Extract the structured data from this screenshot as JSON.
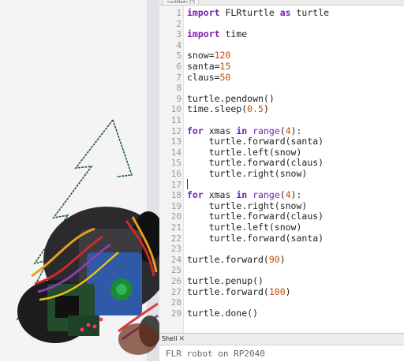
{
  "editor": {
    "tab_label": "<untitled> [*]",
    "lines": [
      {
        "n": "1",
        "parts": [
          {
            "t": "import",
            "c": "kw"
          },
          {
            "t": " FLRturtle ",
            "c": ""
          },
          {
            "t": "as",
            "c": "kw"
          },
          {
            "t": " turtle",
            "c": ""
          }
        ]
      },
      {
        "n": "2",
        "parts": []
      },
      {
        "n": "3",
        "parts": [
          {
            "t": "import",
            "c": "kw"
          },
          {
            "t": " time",
            "c": ""
          }
        ]
      },
      {
        "n": "4",
        "parts": []
      },
      {
        "n": "5",
        "parts": [
          {
            "t": "snow=",
            "c": ""
          },
          {
            "t": "120",
            "c": "num"
          }
        ]
      },
      {
        "n": "6",
        "parts": [
          {
            "t": "santa=",
            "c": ""
          },
          {
            "t": "15",
            "c": "num"
          }
        ]
      },
      {
        "n": "7",
        "parts": [
          {
            "t": "claus=",
            "c": ""
          },
          {
            "t": "50",
            "c": "num"
          }
        ]
      },
      {
        "n": "8",
        "parts": []
      },
      {
        "n": "9",
        "parts": [
          {
            "t": "turtle.pendown()",
            "c": ""
          }
        ]
      },
      {
        "n": "10",
        "parts": [
          {
            "t": "time.sleep(",
            "c": ""
          },
          {
            "t": "0.5",
            "c": "num"
          },
          {
            "t": ")",
            "c": ""
          }
        ]
      },
      {
        "n": "11",
        "parts": []
      },
      {
        "n": "12",
        "parts": [
          {
            "t": "for",
            "c": "kw"
          },
          {
            "t": " xmas ",
            "c": ""
          },
          {
            "t": "in",
            "c": "kw"
          },
          {
            "t": " ",
            "c": ""
          },
          {
            "t": "range",
            "c": "bi"
          },
          {
            "t": "(",
            "c": ""
          },
          {
            "t": "4",
            "c": "num"
          },
          {
            "t": "):",
            "c": ""
          }
        ]
      },
      {
        "n": "13",
        "parts": [
          {
            "t": "    turtle.forward(santa)",
            "c": ""
          }
        ]
      },
      {
        "n": "14",
        "parts": [
          {
            "t": "    turtle.left(snow)",
            "c": ""
          }
        ]
      },
      {
        "n": "15",
        "parts": [
          {
            "t": "    turtle.forward(claus)",
            "c": ""
          }
        ]
      },
      {
        "n": "16",
        "parts": [
          {
            "t": "    turtle.right(snow)",
            "c": ""
          }
        ]
      },
      {
        "n": "17",
        "parts": []
      },
      {
        "n": "18",
        "parts": [
          {
            "t": "for",
            "c": "kw"
          },
          {
            "t": " xmas ",
            "c": ""
          },
          {
            "t": "in",
            "c": "kw"
          },
          {
            "t": " ",
            "c": ""
          },
          {
            "t": "range",
            "c": "bi"
          },
          {
            "t": "(",
            "c": ""
          },
          {
            "t": "4",
            "c": "num"
          },
          {
            "t": "):",
            "c": ""
          }
        ]
      },
      {
        "n": "19",
        "parts": [
          {
            "t": "    turtle.right(snow)",
            "c": ""
          }
        ]
      },
      {
        "n": "20",
        "parts": [
          {
            "t": "    turtle.forward(claus)",
            "c": ""
          }
        ]
      },
      {
        "n": "21",
        "parts": [
          {
            "t": "    turtle.left(snow)",
            "c": ""
          }
        ]
      },
      {
        "n": "22",
        "parts": [
          {
            "t": "    turtle.forward(santa)",
            "c": ""
          }
        ]
      },
      {
        "n": "23",
        "parts": []
      },
      {
        "n": "24",
        "parts": [
          {
            "t": "turtle.forward(",
            "c": ""
          },
          {
            "t": "90",
            "c": "num"
          },
          {
            "t": ")",
            "c": ""
          }
        ]
      },
      {
        "n": "25",
        "parts": []
      },
      {
        "n": "26",
        "parts": [
          {
            "t": "turtle.penup()",
            "c": ""
          }
        ]
      },
      {
        "n": "27",
        "parts": [
          {
            "t": "turtle.forward(",
            "c": ""
          },
          {
            "t": "100",
            "c": "num"
          },
          {
            "t": ")",
            "c": ""
          }
        ]
      },
      {
        "n": "28",
        "parts": []
      },
      {
        "n": "29",
        "parts": [
          {
            "t": "turtle.done()",
            "c": ""
          }
        ]
      }
    ]
  },
  "shell": {
    "tab_label": "Shell",
    "close_icon": "✕",
    "output": "FLR robot on RP2040"
  },
  "colors": {
    "keyword": "#7a1eaf",
    "number": "#c24a00",
    "tree_line": "#1f5a33"
  }
}
